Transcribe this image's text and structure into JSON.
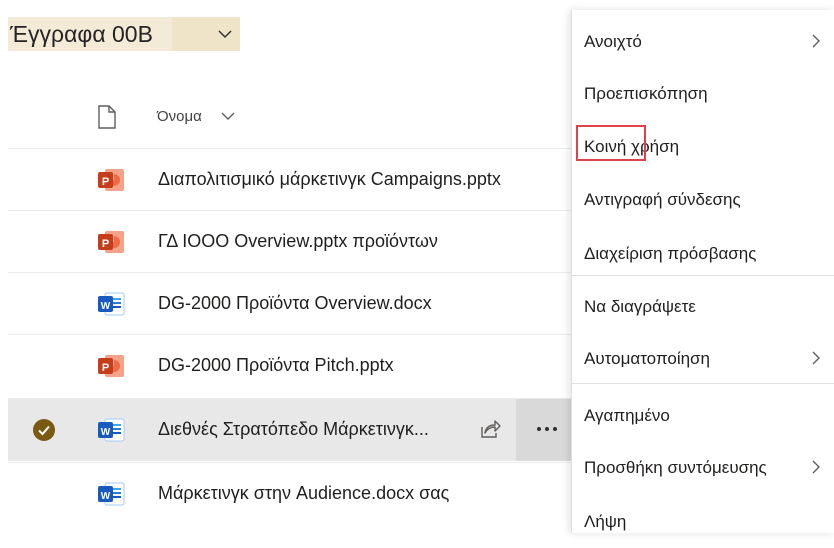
{
  "library": {
    "title": "Έγγραφα 00B",
    "title_chevron_icon": "chevron-down-icon"
  },
  "list_header": {
    "file_type_icon": "document-icon",
    "name_label": "Όνομα",
    "sort_icon": "chevron-down-icon"
  },
  "files": [
    {
      "name": "Διαπολιτισμικό μάρκετινγκ Campaigns.pptx",
      "type": "powerpoint",
      "selected": false
    },
    {
      "name": "ΓΔ ΙΟΟΟ Overview.pptx προϊόντων",
      "type": "powerpoint",
      "selected": false
    },
    {
      "name": "DG-2000 Προϊόντα Overview.docx",
      "type": "word",
      "selected": false
    },
    {
      "name": "DG-2000 Προϊόντα Pitch.pptx",
      "type": "powerpoint",
      "selected": false
    },
    {
      "name": "Διεθνές Στρατόπεδο Μάρκετινγκ...",
      "type": "word",
      "selected": true
    },
    {
      "name": "Μάρκετινγκ στην Audience.docx σας",
      "type": "word",
      "selected": false
    }
  ],
  "row_actions": {
    "share_icon": "share-icon",
    "more_icon": "more-icon"
  },
  "context_menu": {
    "items": [
      {
        "label": "Ανοιχτό",
        "submenu": true
      },
      {
        "label": "Προεπισκόπηση",
        "submenu": false
      },
      {
        "label": "Κοινή χρήση",
        "submenu": false,
        "highlighted": true
      },
      {
        "label": "Αντιγραφή σύνδεσης",
        "submenu": false
      },
      {
        "label": "Διαχείριση πρόσβασης",
        "submenu": false
      },
      {
        "label": "Να διαγράψετε",
        "submenu": false
      },
      {
        "label": "Αυτοματοποίηση",
        "submenu": true
      },
      {
        "label": "Αγαπημένο",
        "submenu": false
      },
      {
        "label": "Προσθήκη συντόμευσης",
        "submenu": true
      },
      {
        "label": "Λήψη",
        "submenu": false
      }
    ]
  },
  "colors": {
    "powerpoint": "#c43e1c",
    "word": "#185abd",
    "check": "#7a5a12",
    "highlight_border": "#e0424a"
  }
}
